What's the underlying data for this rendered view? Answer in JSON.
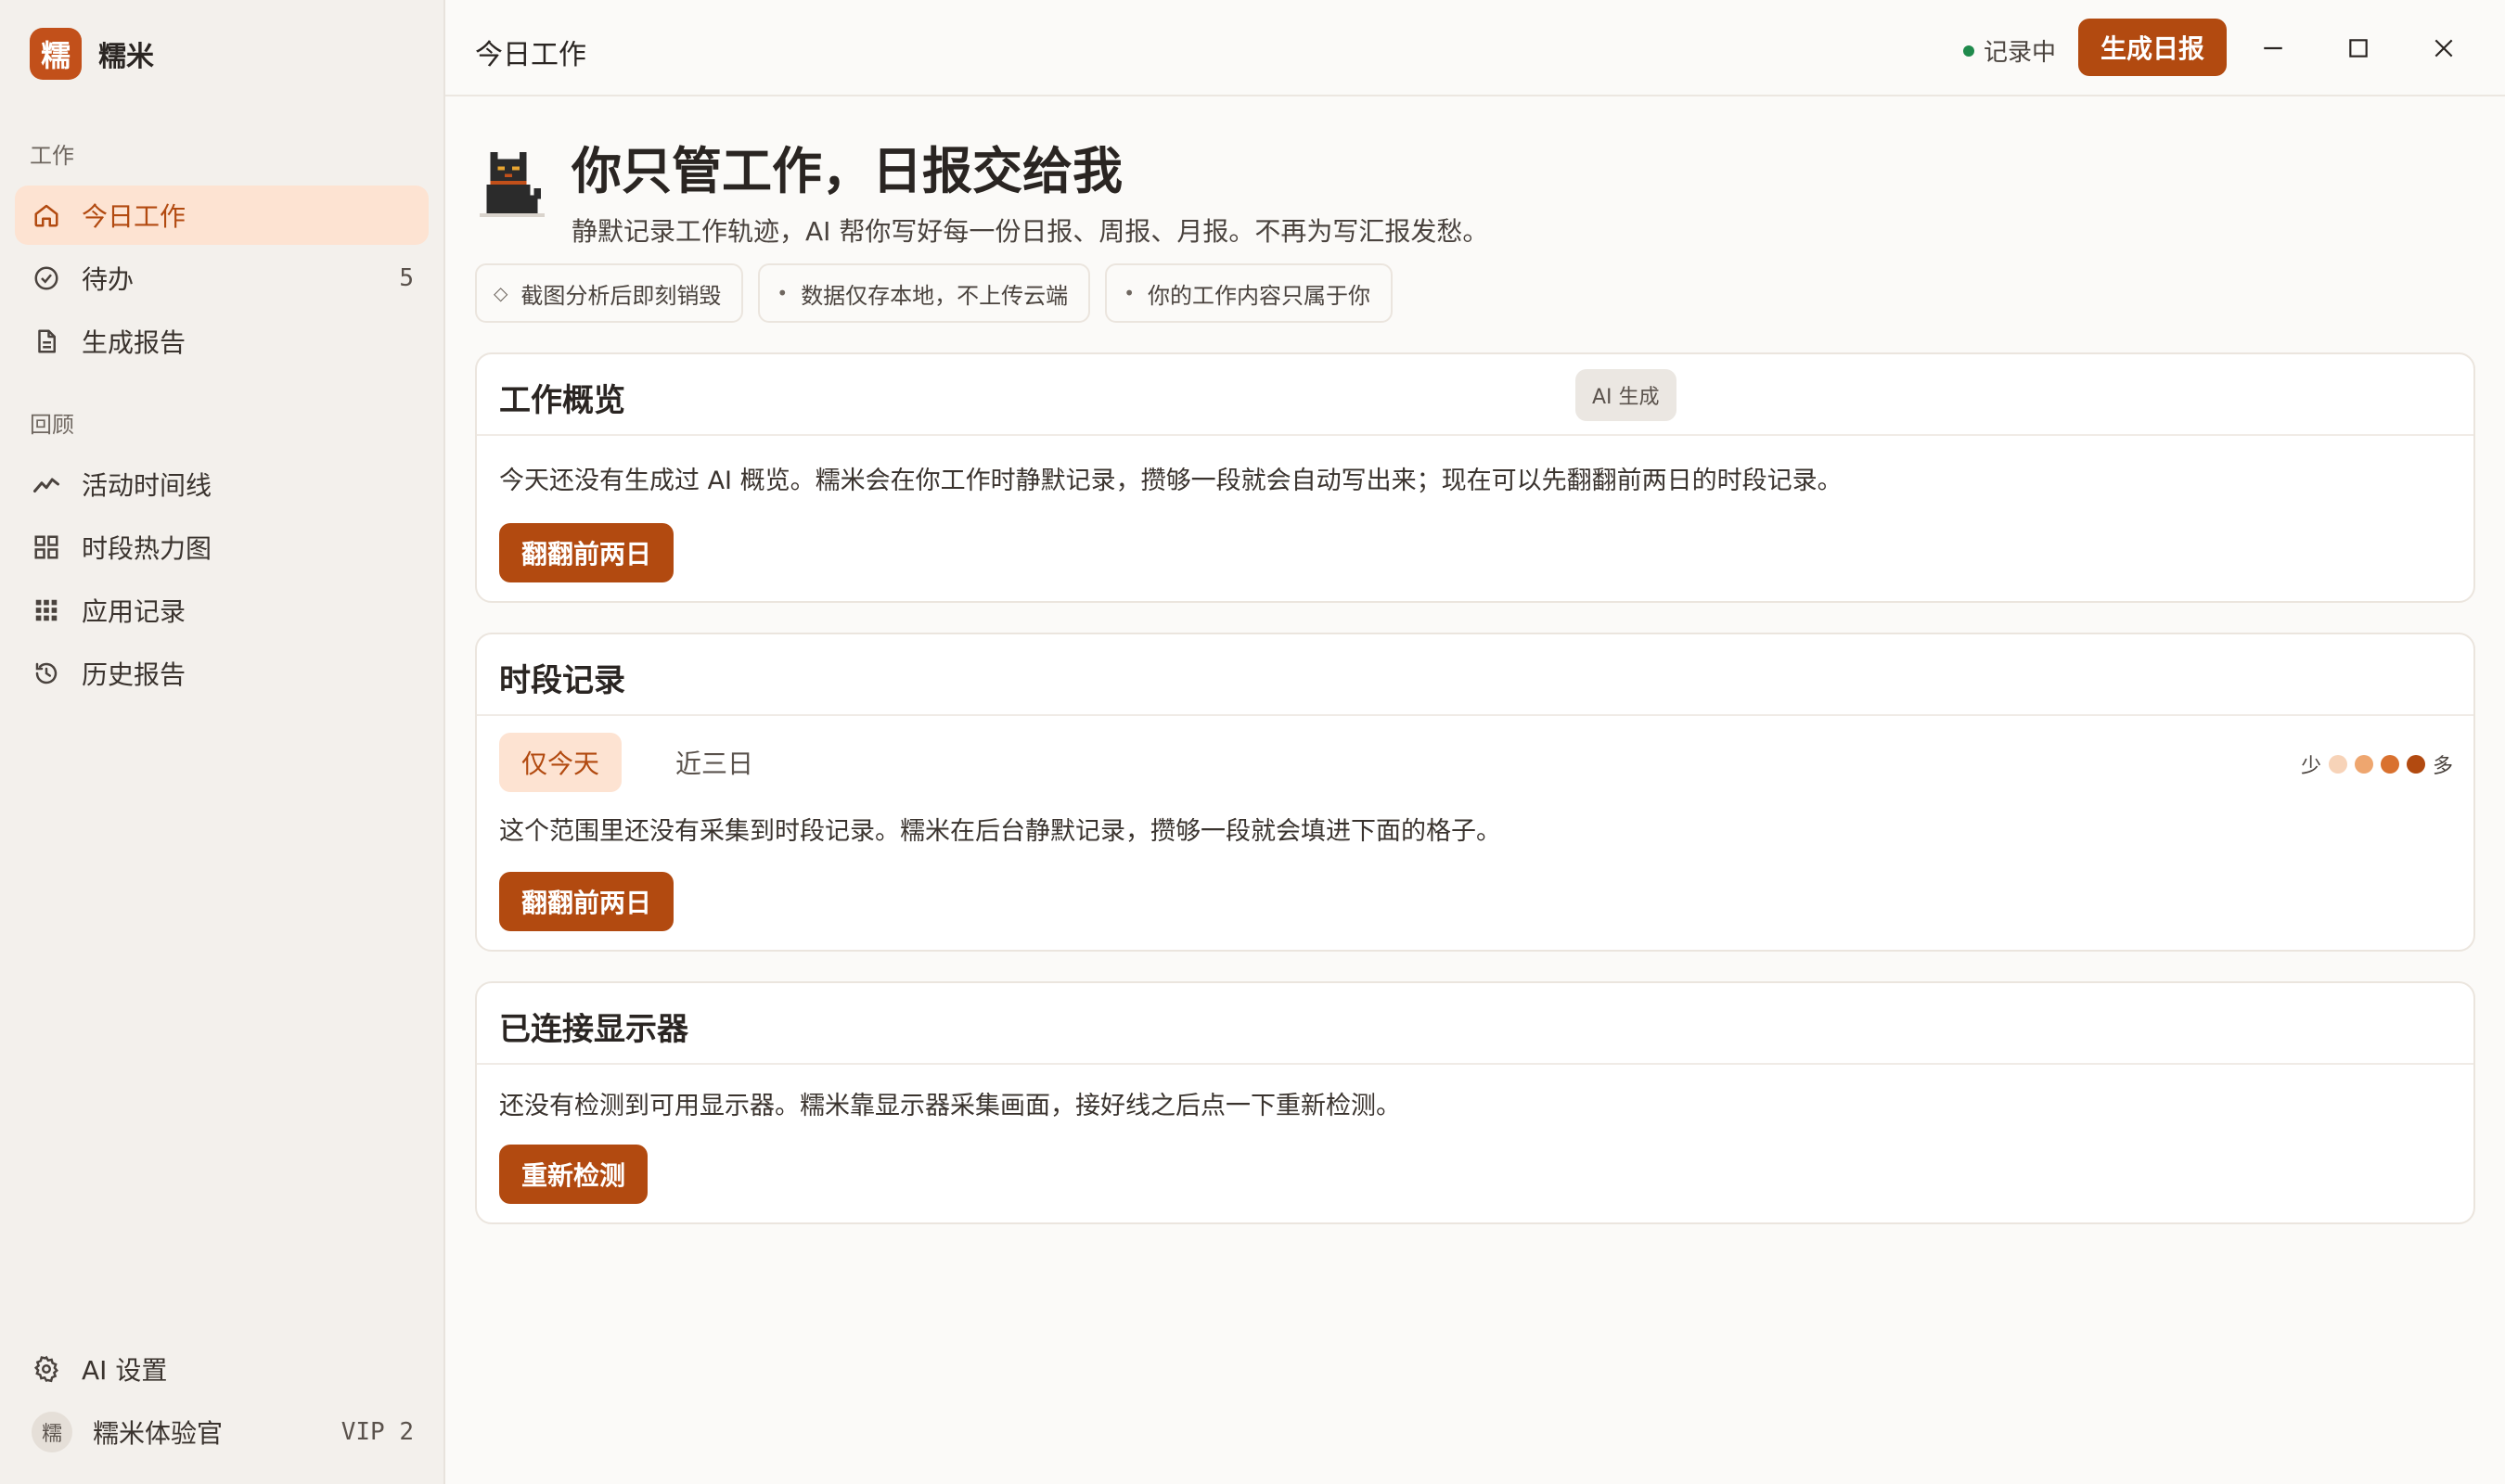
{
  "app": {
    "logo_char": "糯",
    "name": "糯米"
  },
  "sidebar": {
    "section_work": "工作",
    "work_items": [
      {
        "label": "今日工作",
        "icon": "home-icon"
      },
      {
        "label": "待办",
        "icon": "check-circle-icon",
        "count": "5"
      },
      {
        "label": "生成报告",
        "icon": "document-icon"
      }
    ],
    "section_review": "回顾",
    "review_items": [
      {
        "label": "活动时间线",
        "icon": "trend-line-icon"
      },
      {
        "label": "时段热力图",
        "icon": "grid-icon"
      },
      {
        "label": "应用记录",
        "icon": "apps-grid-icon"
      },
      {
        "label": "历史报告",
        "icon": "history-icon"
      }
    ],
    "settings_label": "AI 设置",
    "user": {
      "avatar_char": "糯",
      "name": "糯米体验官",
      "level": "VIP 2"
    }
  },
  "topbar": {
    "title": "今日工作",
    "status": "记录中",
    "generate_button": "生成日报"
  },
  "hero": {
    "title": "你只管工作，日报交给我",
    "subtitle": "静默记录工作轨迹，AI 帮你写好每一份日报、周报、月报。不再为写汇报发愁。",
    "chips": [
      {
        "icon": "◇",
        "text": "截图分析后即刻销毁"
      },
      {
        "icon": "•",
        "text": "数据仅存本地，不上传云端"
      },
      {
        "icon": "•",
        "text": "你的工作内容只属于你"
      }
    ]
  },
  "overview": {
    "title": "工作概览",
    "badge": "AI 生成",
    "text": "今天还没有生成过 AI 概览。糯米会在你工作时静默记录，攒够一段就会自动写出来；现在可以先翻翻前两日的时段记录。",
    "button": "翻翻前两日"
  },
  "periods": {
    "title": "时段记录",
    "tabs": [
      "仅今天",
      "近三日"
    ],
    "legend_low": "少",
    "legend_high": "多",
    "legend_colors": [
      "#f7d3b8",
      "#eea66f",
      "#d9712f",
      "#b24a10"
    ],
    "text": "这个范围里还没有采集到时段记录。糯米在后台静默记录，攒够一段就会填进下面的格子。",
    "button": "翻翻前两日"
  },
  "displays": {
    "title": "已连接显示器",
    "text": "还没有检测到可用显示器。糯米靠显示器采集画面，接好线之后点一下重新检测。",
    "button": "重新检测"
  },
  "colors": {
    "accent": "#b24a10",
    "accent_soft": "#fde3d2",
    "status_green": "#1f8a4c"
  }
}
